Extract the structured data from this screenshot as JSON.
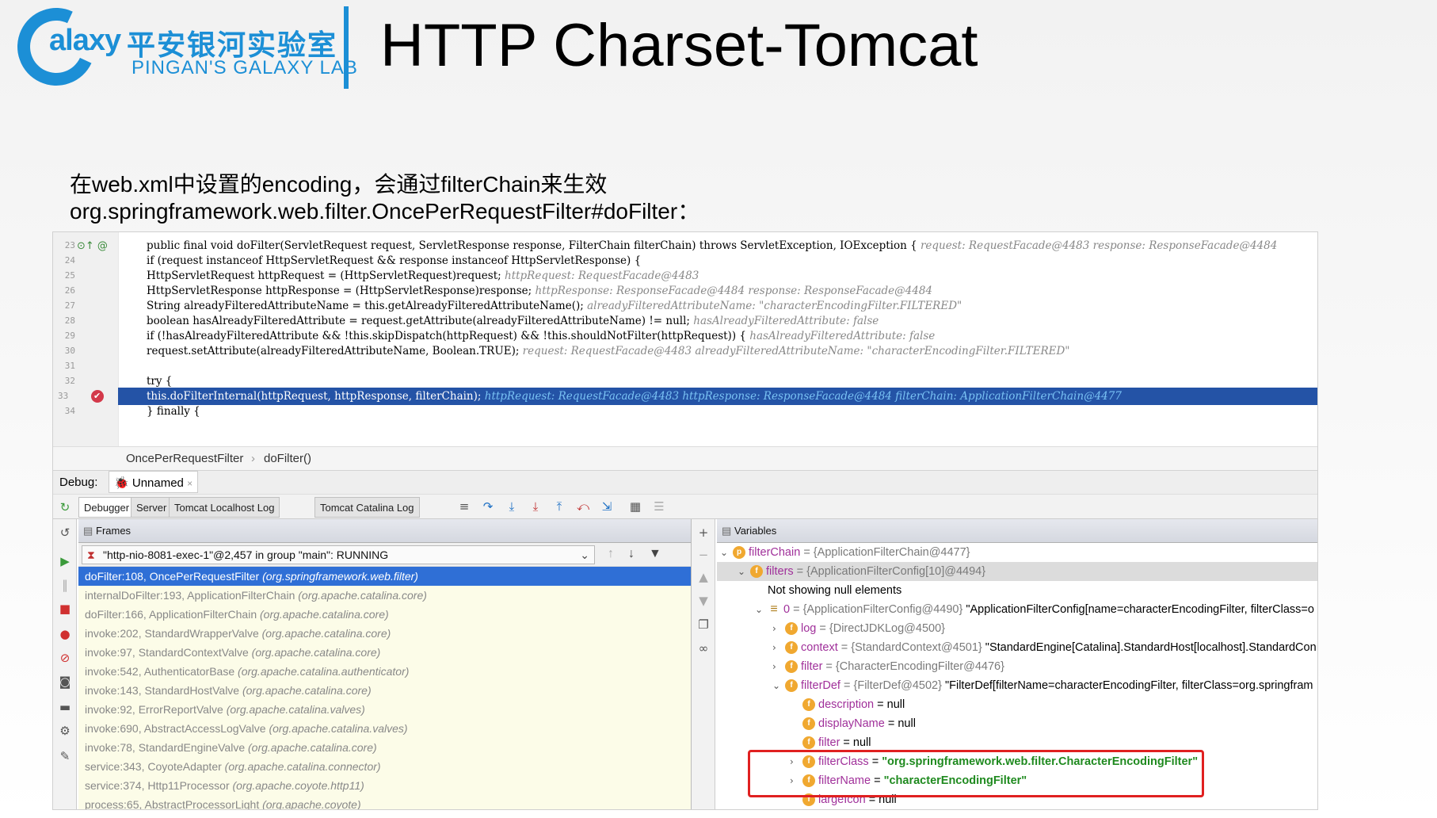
{
  "header": {
    "logo_word": "alaxy",
    "logo_cn": "平安银河实验室",
    "logo_en": "PINGAN'S GALAXY LAB",
    "title": "HTTP Charset-Tomcat"
  },
  "intro": {
    "line1": "在web.xml中设置的encoding，会通过filterChain来生效",
    "line2": "org.springframework.web.filter.OncePerRequestFilter#doFilter："
  },
  "editor": {
    "line_numbers": [
      "23",
      "24",
      "25",
      "26",
      "27",
      "28",
      "29",
      "30",
      "31",
      "32",
      "33",
      "34"
    ],
    "lines": [
      {
        "code": "public final void doFilter(ServletRequest request, ServletResponse response, FilterChain filterChain) throws ServletException, IOException {",
        "hint": "request: RequestFacade@4483   response: ResponseFacade@4484"
      },
      {
        "code": "    if (request instanceof HttpServletRequest && response instanceof HttpServletResponse) {",
        "hint": ""
      },
      {
        "code": "        HttpServletRequest httpRequest = (HttpServletRequest)request;",
        "hint": "httpRequest: RequestFacade@4483"
      },
      {
        "code": "        HttpServletResponse httpResponse = (HttpServletResponse)response;",
        "hint": "httpResponse: ResponseFacade@4484  response: ResponseFacade@4484"
      },
      {
        "code": "        String alreadyFilteredAttributeName = this.getAlreadyFilteredAttributeName();",
        "hint": "alreadyFilteredAttributeName: \"characterEncodingFilter.FILTERED\""
      },
      {
        "code": "        boolean hasAlreadyFilteredAttribute = request.getAttribute(alreadyFilteredAttributeName) != null;",
        "hint": "hasAlreadyFilteredAttribute: false"
      },
      {
        "code": "        if (!hasAlreadyFilteredAttribute && !this.skipDispatch(httpRequest) && !this.shouldNotFilter(httpRequest)) {",
        "hint": "hasAlreadyFilteredAttribute: false"
      },
      {
        "code": "            request.setAttribute(alreadyFilteredAttributeName, Boolean.TRUE);",
        "hint": "request: RequestFacade@4483  alreadyFilteredAttributeName: \"characterEncodingFilter.FILTERED\""
      },
      {
        "code": "",
        "hint": ""
      },
      {
        "code": "            try {",
        "hint": ""
      },
      {
        "code": "                this.doFilterInternal(httpRequest, httpResponse, filterChain);",
        "hint": "httpRequest: RequestFacade@4483  httpResponse: ResponseFacade@4484  filterChain: ApplicationFilterChain@4477"
      },
      {
        "code": "            } finally {",
        "hint": ""
      }
    ]
  },
  "breadcrumb": {
    "class": "OncePerRequestFilter",
    "method": "doFilter()"
  },
  "debug": {
    "label": "Debug:",
    "session": "Unnamed",
    "tabs": [
      "Debugger",
      "Server",
      "Tomcat Localhost Log",
      "Tomcat Catalina Log"
    ]
  },
  "frames": {
    "title": "Frames",
    "thread": "\"http-nio-8081-exec-1\"@2,457 in group \"main\": RUNNING",
    "items": [
      {
        "method": "doFilter:108, OncePerRequestFilter",
        "pkg": "(org.springframework.web.filter)"
      },
      {
        "method": "internalDoFilter:193, ApplicationFilterChain",
        "pkg": "(org.apache.catalina.core)"
      },
      {
        "method": "doFilter:166, ApplicationFilterChain",
        "pkg": "(org.apache.catalina.core)"
      },
      {
        "method": "invoke:202, StandardWrapperValve",
        "pkg": "(org.apache.catalina.core)"
      },
      {
        "method": "invoke:97, StandardContextValve",
        "pkg": "(org.apache.catalina.core)"
      },
      {
        "method": "invoke:542, AuthenticatorBase",
        "pkg": "(org.apache.catalina.authenticator)"
      },
      {
        "method": "invoke:143, StandardHostValve",
        "pkg": "(org.apache.catalina.core)"
      },
      {
        "method": "invoke:92, ErrorReportValve",
        "pkg": "(org.apache.catalina.valves)"
      },
      {
        "method": "invoke:690, AbstractAccessLogValve",
        "pkg": "(org.apache.catalina.valves)"
      },
      {
        "method": "invoke:78, StandardEngineValve",
        "pkg": "(org.apache.catalina.core)"
      },
      {
        "method": "service:343, CoyoteAdapter",
        "pkg": "(org.apache.catalina.connector)"
      },
      {
        "method": "service:374, Http11Processor",
        "pkg": "(org.apache.coyote.http11)"
      },
      {
        "method": "process:65, AbstractProcessorLight",
        "pkg": "(org.apache.coyote)"
      }
    ]
  },
  "variables": {
    "title": "Variables",
    "rows": [
      {
        "name": "filterChain",
        "val": "= {ApplicationFilterChain@4477}",
        "extra": ""
      },
      {
        "name": "filters",
        "val": "= {ApplicationFilterConfig[10]@4494}",
        "extra": ""
      },
      {
        "name": "",
        "val": "Not showing null elements",
        "extra": ""
      },
      {
        "name": "0",
        "val": "= {ApplicationFilterConfig@4490}",
        "extra": "\"ApplicationFilterConfig[name=characterEncodingFilter, filterClass=o"
      },
      {
        "name": "log",
        "val": "= {DirectJDKLog@4500}",
        "extra": ""
      },
      {
        "name": "context",
        "val": "= {StandardContext@4501}",
        "extra": "\"StandardEngine[Catalina].StandardHost[localhost].StandardCon"
      },
      {
        "name": "filter",
        "val": "= {CharacterEncodingFilter@4476}",
        "extra": ""
      },
      {
        "name": "filterDef",
        "val": "= {FilterDef@4502}",
        "extra": "\"FilterDef[filterName=characterEncodingFilter, filterClass=org.springfram"
      },
      {
        "name": "description",
        "val": "= null",
        "extra": ""
      },
      {
        "name": "displayName",
        "val": "= null",
        "extra": ""
      },
      {
        "name": "filter",
        "val": "= null",
        "extra": ""
      },
      {
        "name": "filterClass",
        "val": "= ",
        "extra": "\"org.springframework.web.filter.CharacterEncodingFilter\""
      },
      {
        "name": "filterName",
        "val": "= ",
        "extra": "\"characterEncodingFilter\""
      },
      {
        "name": "largeIcon",
        "val": "= null",
        "extra": ""
      }
    ]
  },
  "colors": {
    "accent": "#1c8fd6",
    "selection": "#2f6fd6",
    "highlight": "#e02020"
  }
}
